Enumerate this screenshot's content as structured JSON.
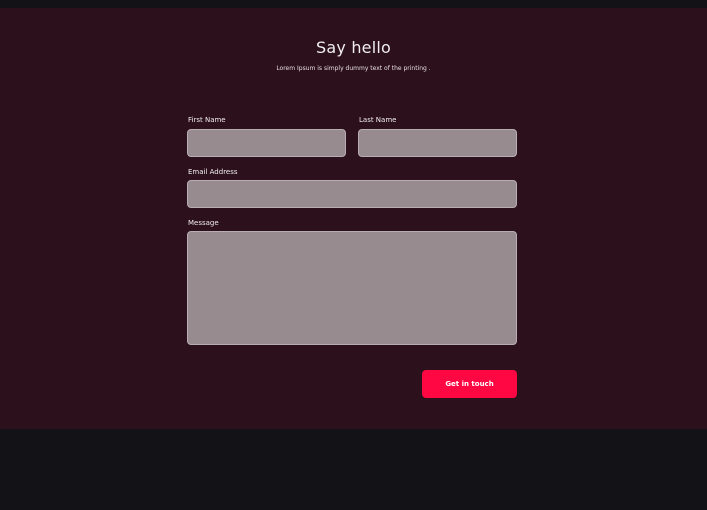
{
  "header": {
    "title": "Say hello",
    "subtitle": "Lorem Ipsum is simply dummy text of the printing ."
  },
  "form": {
    "first_name": {
      "label": "First Name",
      "value": "",
      "placeholder": ""
    },
    "last_name": {
      "label": "Last Name",
      "value": "",
      "placeholder": ""
    },
    "email": {
      "label": "Email Address",
      "value": "",
      "placeholder": ""
    },
    "message": {
      "label": "Message",
      "value": "",
      "placeholder": ""
    },
    "submit_label": "Get in touch"
  },
  "colors": {
    "section_background": "#2c101b",
    "page_background": "#131317",
    "field_background": "#978b8f",
    "accent": "#ff0742"
  }
}
